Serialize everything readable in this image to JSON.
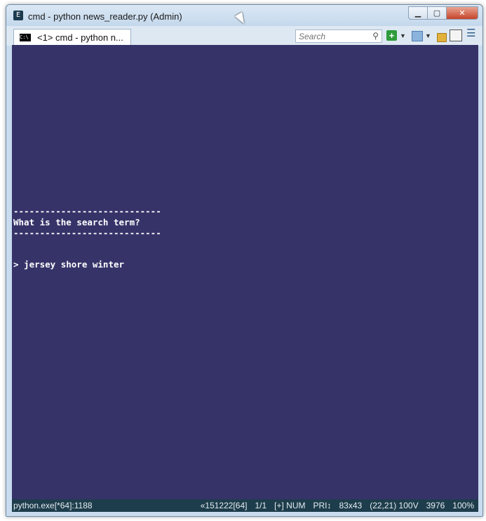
{
  "window": {
    "title": "cmd - python  news_reader.py (Admin)",
    "controls": {
      "minimize": "▁",
      "maximize": "▢",
      "close": "✕"
    }
  },
  "toolbar": {
    "tab_label": "<1> cmd - python  n...",
    "search_placeholder": "Search",
    "icons": [
      "plus-icon",
      "dropdown-icon",
      "split-icon",
      "lock-icon",
      "panel-icon",
      "menu-icon"
    ]
  },
  "console": {
    "lines": [
      "----------------------------",
      "What is the search term?",
      "----------------------------",
      "> jersey shore winter"
    ],
    "background": "#363369",
    "foreground": "#ffffff"
  },
  "status": {
    "process": "python.exe[*64]:1188",
    "items": [
      "«151222[64]",
      "1/1",
      "[+] NUM",
      "PRI↕",
      "83x43",
      "(22,21) 100V",
      "3976",
      "100%"
    ]
  }
}
